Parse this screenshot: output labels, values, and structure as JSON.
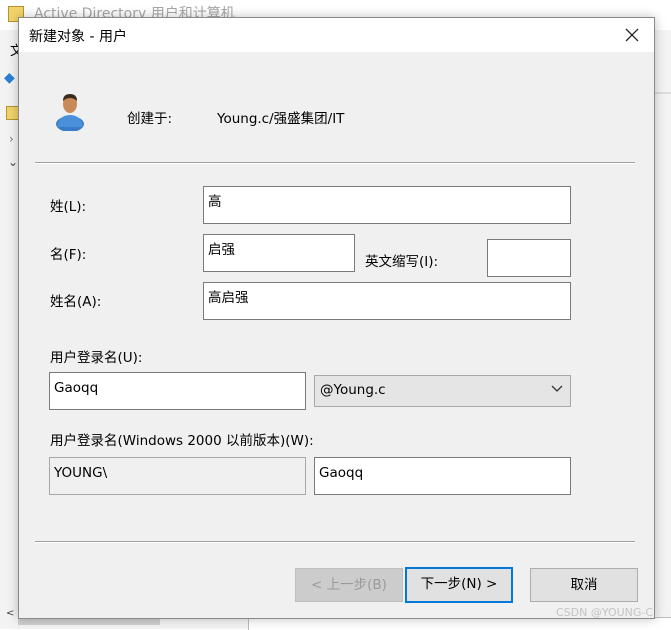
{
  "background_window": {
    "title": "Active Directory 用户和计算机",
    "menu_letter": "文"
  },
  "dialog": {
    "title": "新建对象 - 用户",
    "created_in_label": "创建于:",
    "created_in_value": "Young.c/强盛集团/IT"
  },
  "form": {
    "last_name_label": "姓(L):",
    "last_name_value": "高",
    "first_name_label": "名(F):",
    "first_name_value": "启强",
    "initials_label": "英文缩写(I):",
    "initials_value": "",
    "full_name_label": "姓名(A):",
    "full_name_value": "高启强",
    "logon_label": "用户登录名(U):",
    "logon_value": "Gaoqq",
    "domain_selected": "@Young.c",
    "pre2000_label": "用户登录名(Windows 2000 以前版本)(W):",
    "pre2000_prefix": "YOUNG\\",
    "pre2000_value": "Gaoqq"
  },
  "buttons": {
    "back_label": "< 上一步(B)",
    "next_label": "下一步(N) >",
    "cancel_label": "取消"
  },
  "watermark": "CSDN @YOUNG-C",
  "icons": {
    "user": "user-icon",
    "close": "close-icon",
    "dropdown": "chevron-down-icon"
  },
  "colors": {
    "accent": "#0078d7",
    "dialog_bg": "#f0f0f0"
  }
}
